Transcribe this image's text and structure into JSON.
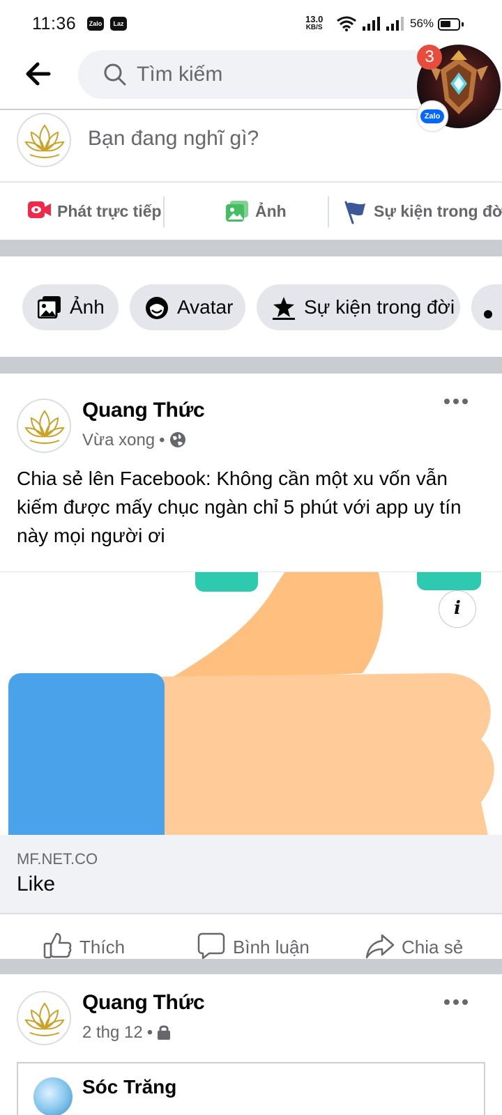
{
  "status_bar": {
    "time": "11:36",
    "app_icons": [
      "Zalo",
      "Laz"
    ],
    "speed_value": "13.0",
    "speed_unit": "KB/S",
    "battery": "56%"
  },
  "header": {
    "search_placeholder": "Tìm kiếm"
  },
  "bubble": {
    "badge_count": "3",
    "chip_label": "Zalo"
  },
  "composer": {
    "prompt": "Bạn đang nghĩ gì?",
    "actions": [
      {
        "label": "Phát trực tiếp",
        "icon": "live-video-icon",
        "color": "#f02849"
      },
      {
        "label": "Ảnh",
        "icon": "photo-icon",
        "color": "#45bd62"
      },
      {
        "label": "Sự kiện trong đời",
        "icon": "flag-icon",
        "color": "#3578e5"
      }
    ]
  },
  "chips": [
    {
      "label": "Ảnh",
      "icon": "photo-icon"
    },
    {
      "label": "Avatar",
      "icon": "avatar-face-icon"
    },
    {
      "label": "Sự kiện trong đời",
      "icon": "star-flag-icon"
    }
  ],
  "post1": {
    "author": "Quang Thức",
    "time": "Vừa xong",
    "privacy_icon": "globe-icon",
    "body": "Chia sẻ lên Facebook: Không cần một xu vốn vẫn kiếm được mấy chục ngàn chỉ 5 phút với app uy tín này mọi người ơi",
    "link_domain": "MF.NET.CO",
    "link_title": "Like",
    "reactions": {
      "like": "Thích",
      "comment": "Bình luận",
      "share": "Chia sẻ"
    }
  },
  "post2": {
    "author": "Quang Thức",
    "time": "2 thg 12",
    "privacy_icon": "lock-icon",
    "shared_page": "Sóc Trăng"
  },
  "colors": {
    "separator": "#c9ccd1",
    "chip_bg": "#e4e6eb",
    "secondary_text": "#65676b",
    "thumb_blue": "#4aa3ea",
    "thumb_skin": "#ffcc99",
    "thumb_teal": "#2ecab0"
  }
}
